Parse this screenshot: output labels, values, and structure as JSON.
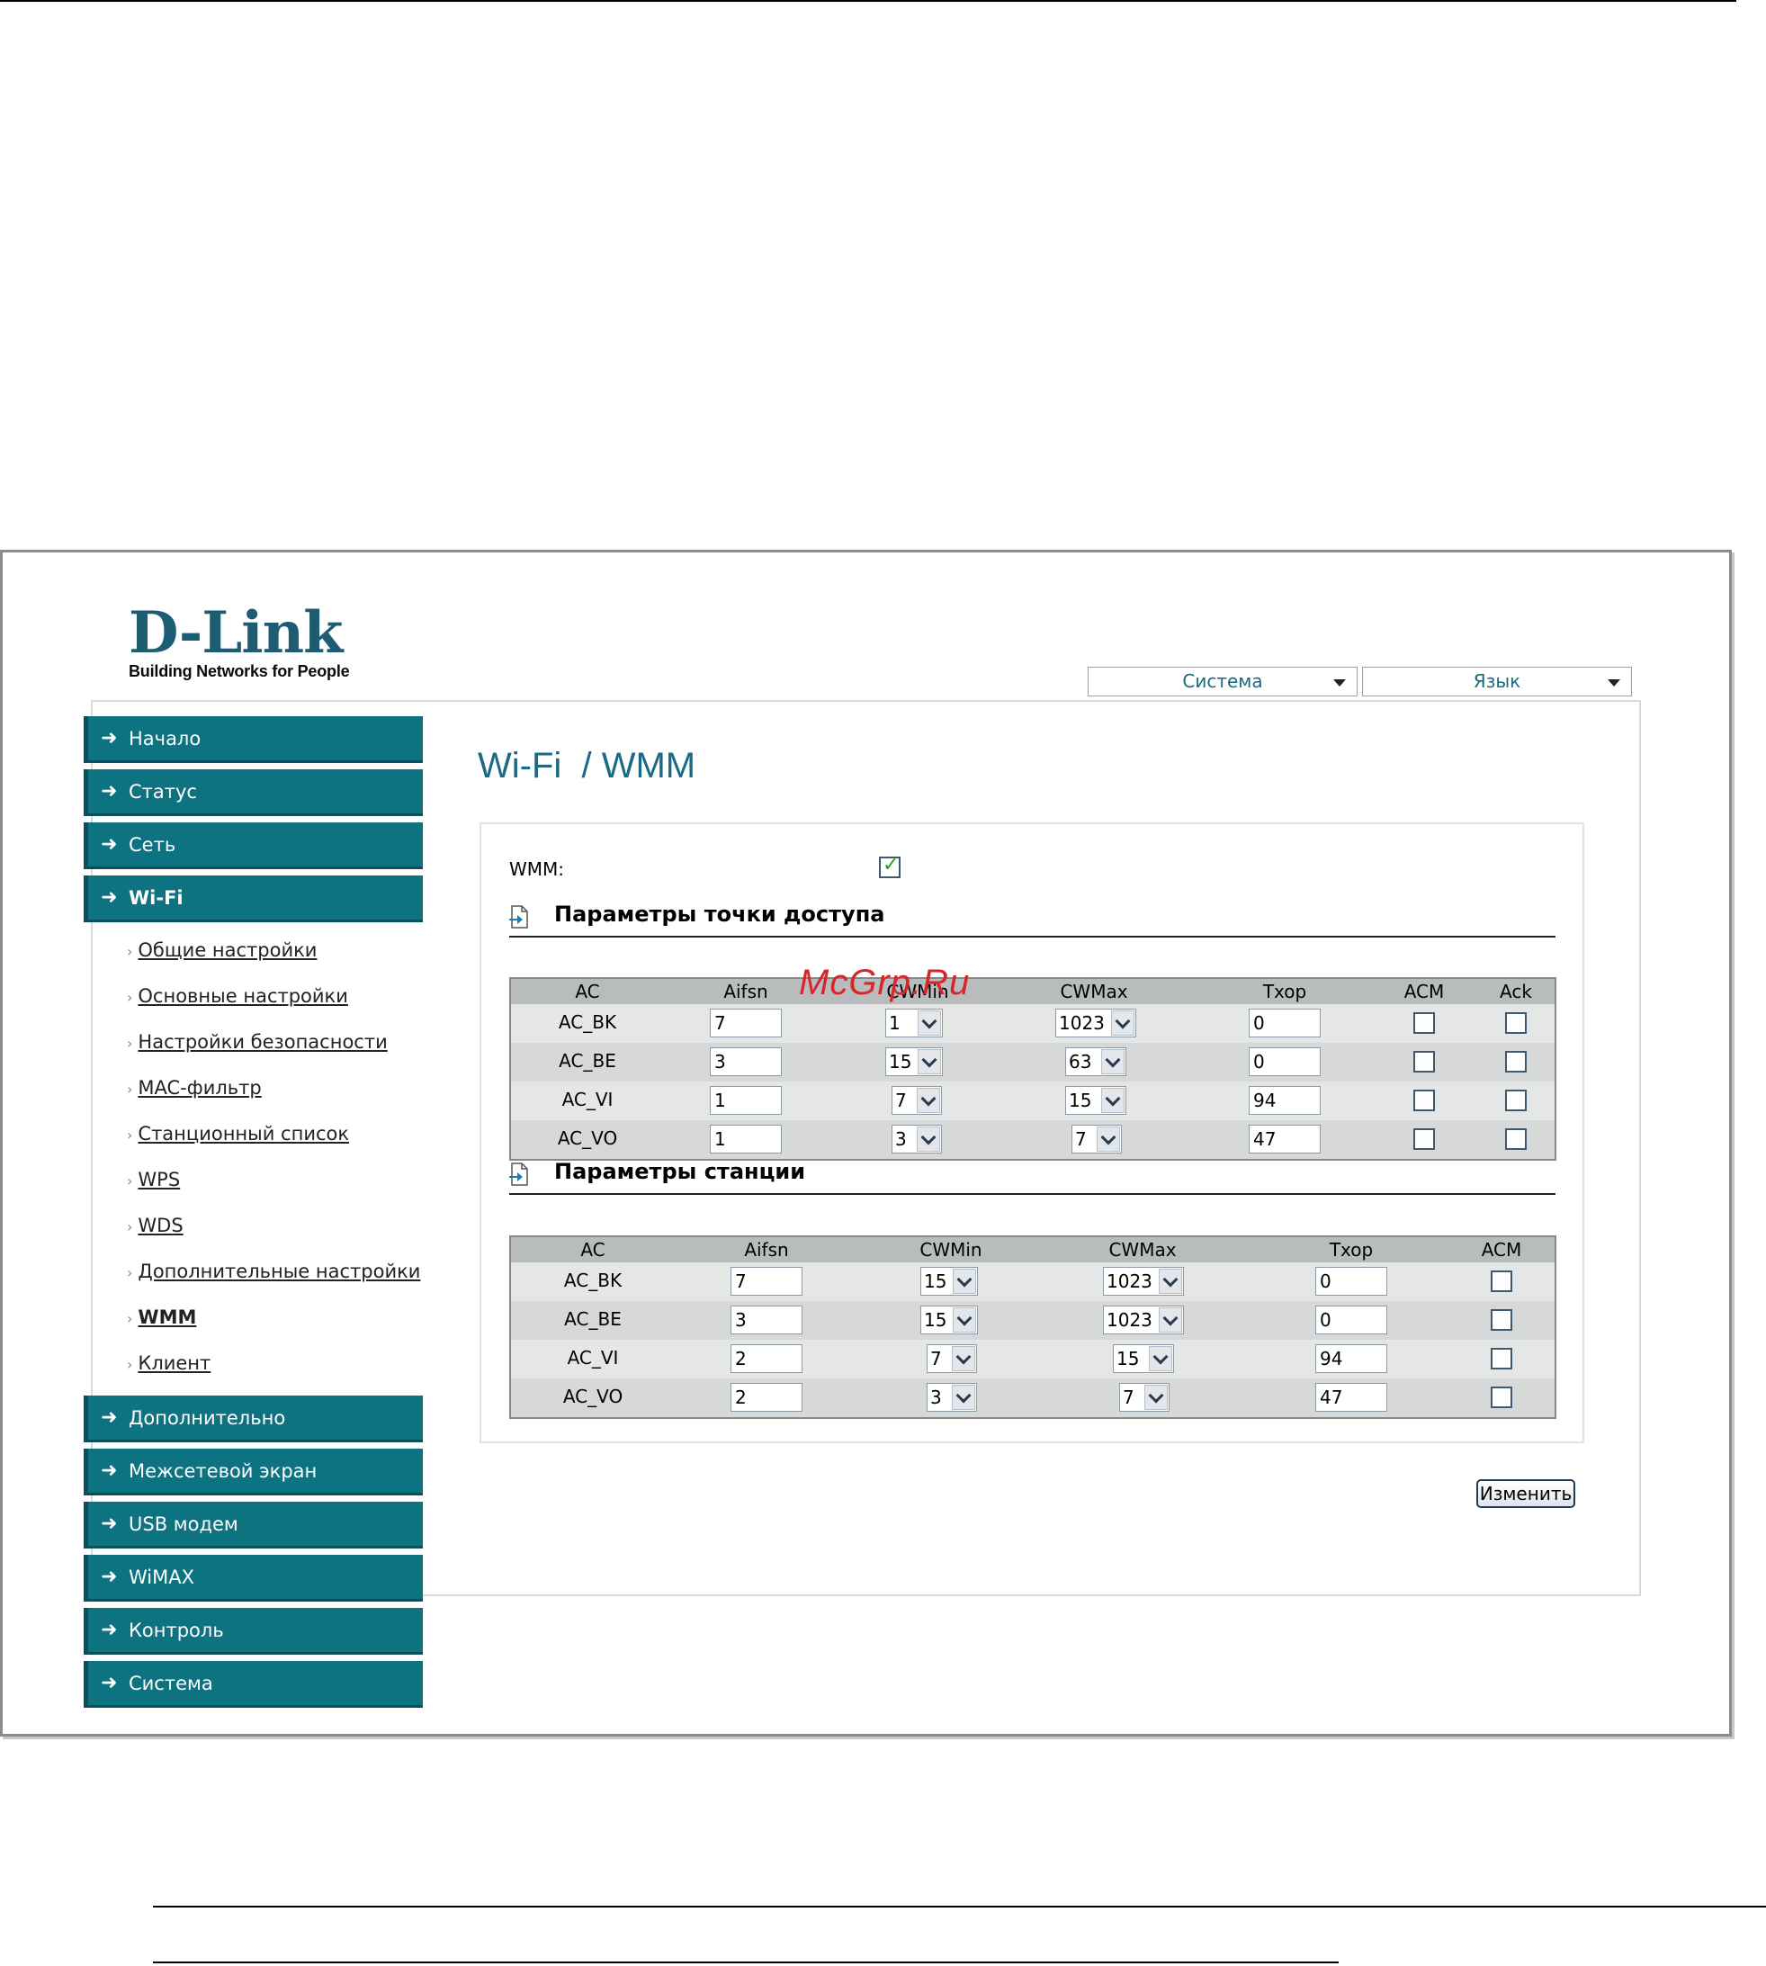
{
  "logo": {
    "brand": "D-Link",
    "tagline": "Building Networks for People"
  },
  "top_menus": {
    "system": "Система",
    "language": "Язык"
  },
  "sidebar": {
    "top_items": [
      {
        "label": "Начало"
      },
      {
        "label": "Статус"
      },
      {
        "label": "Сеть"
      },
      {
        "label": "Wi-Fi"
      }
    ],
    "wifi_sub": [
      {
        "label": "Общие настройки"
      },
      {
        "label": "Основные настройки"
      },
      {
        "label": "Настройки безопасности"
      },
      {
        "label": "MAC-фильтр"
      },
      {
        "label": "Станционный список"
      },
      {
        "label": "WPS"
      },
      {
        "label": "WDS"
      },
      {
        "label": "Дополнительные настройки"
      },
      {
        "label": "WMM"
      },
      {
        "label": "Клиент"
      }
    ],
    "bottom_items": [
      {
        "label": "Дополнительно"
      },
      {
        "label": "Межсетевой экран"
      },
      {
        "label": "USB модем"
      },
      {
        "label": "WiMAX"
      },
      {
        "label": "Контроль"
      },
      {
        "label": "Система"
      }
    ]
  },
  "page": {
    "title": "Wi-Fi  / WMM"
  },
  "wmm": {
    "label": "WMM:",
    "enabled": true
  },
  "ap_params": {
    "title": "Параметры точки доступа",
    "headers": [
      "AC",
      "Aifsn",
      "CWMin",
      "CWMax",
      "Txop",
      "ACM",
      "Ack"
    ],
    "rows": [
      {
        "ac": "AC_BK",
        "aifsn": "7",
        "cwmin": "1",
        "cwmax": "1023",
        "txop": "0"
      },
      {
        "ac": "AC_BE",
        "aifsn": "3",
        "cwmin": "15",
        "cwmax": "63",
        "txop": "0"
      },
      {
        "ac": "AC_VI",
        "aifsn": "1",
        "cwmin": "7",
        "cwmax": "15",
        "txop": "94"
      },
      {
        "ac": "AC_VO",
        "aifsn": "1",
        "cwmin": "3",
        "cwmax": "7",
        "txop": "47"
      }
    ]
  },
  "sta_params": {
    "title": "Параметры станции",
    "headers": [
      "AC",
      "Aifsn",
      "CWMin",
      "CWMax",
      "Txop",
      "ACM"
    ],
    "rows": [
      {
        "ac": "AC_BK",
        "aifsn": "7",
        "cwmin": "15",
        "cwmax": "1023",
        "txop": "0"
      },
      {
        "ac": "AC_BE",
        "aifsn": "3",
        "cwmin": "15",
        "cwmax": "1023",
        "txop": "0"
      },
      {
        "ac": "AC_VI",
        "aifsn": "2",
        "cwmin": "7",
        "cwmax": "15",
        "txop": "94"
      },
      {
        "ac": "AC_VO",
        "aifsn": "2",
        "cwmin": "3",
        "cwmax": "7",
        "txop": "47"
      }
    ]
  },
  "buttons": {
    "apply": "Изменить"
  },
  "watermark": "McGrp.Ru",
  "colors": {
    "menu": "#0d7381",
    "title": "#1a6a86",
    "brand": "#1c5d73"
  }
}
